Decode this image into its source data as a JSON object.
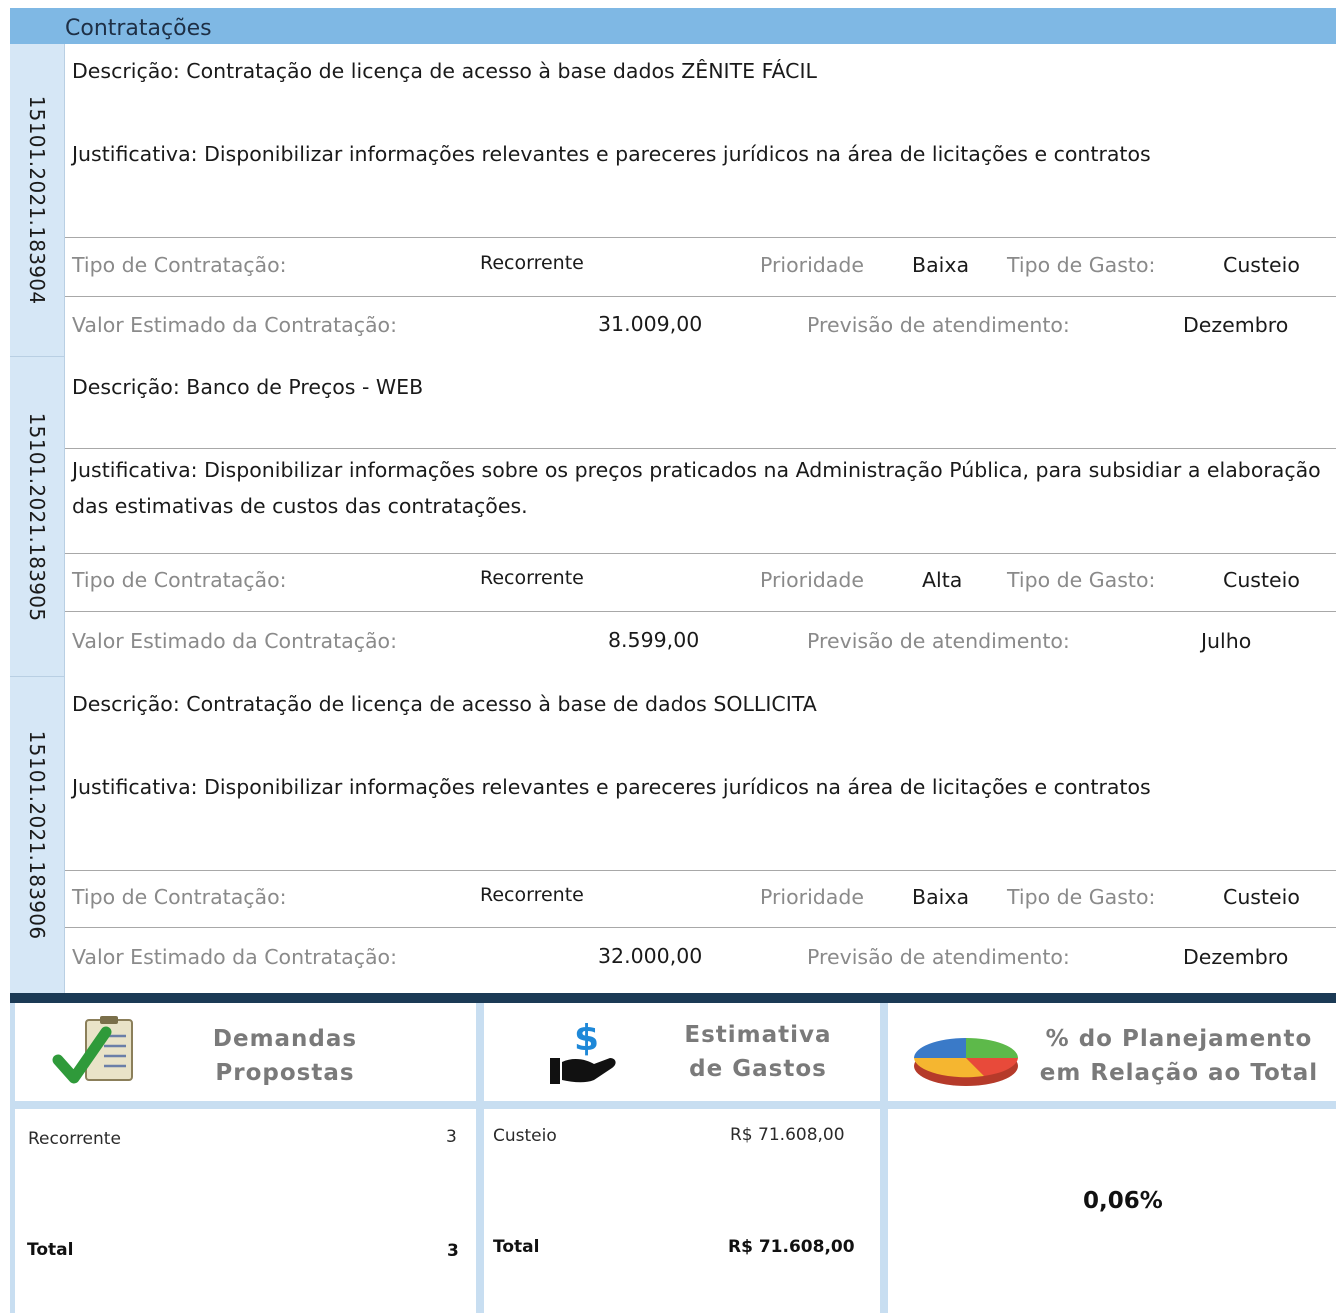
{
  "header": {
    "title": "Contratações"
  },
  "labels": {
    "descricao": "Descrição:",
    "justificativa": "Justificativa:",
    "tipo_contratacao": "Tipo de Contratação:",
    "prioridade": "Prioridade",
    "tipo_gasto": "Tipo de Gasto:",
    "valor_estimado": "Valor Estimado da Contratação:",
    "previsao": "Previsão de atendimento:"
  },
  "items": [
    {
      "id": "15101.2021.183904",
      "descricao": "Contratação de licença de acesso à base dados ZÊNITE FÁCIL",
      "justificativa": "Disponibilizar informações relevantes e pareceres jurídicos na área de licitações e contratos",
      "tipo_contratacao": "Recorrente",
      "prioridade": "Baixa",
      "tipo_gasto": "Custeio",
      "valor": "31.009,00",
      "previsao": "Dezembro"
    },
    {
      "id": "15101.2021.183905",
      "descricao": "Banco de Preços - WEB",
      "justificativa": "Disponibilizar informações sobre os preços praticados na Administração Pública, para subsidiar a elaboração das estimativas de custos das contratações.",
      "tipo_contratacao": "Recorrente",
      "prioridade": "Alta",
      "tipo_gasto": "Custeio",
      "valor": "8.599,00",
      "previsao": "Julho"
    },
    {
      "id": "15101.2021.183906",
      "descricao": "Contratação de licença de acesso à base de dados SOLLICITA",
      "justificativa": "Disponibilizar informações relevantes e pareceres jurídicos na área de licitações e contratos",
      "tipo_contratacao": "Recorrente",
      "prioridade": "Baixa",
      "tipo_gasto": "Custeio",
      "valor": "32.000,00",
      "previsao": "Dezembro"
    }
  ],
  "summary": {
    "demandas": {
      "title_line1": "Demandas",
      "title_line2": "Propostas",
      "row_label": "Recorrente",
      "row_value": "3",
      "total_label": "Total",
      "total_value": "3"
    },
    "estimativa": {
      "title_line1": "Estimativa",
      "title_line2": "de Gastos",
      "row_label": "Custeio",
      "row_value": "R$ 71.608,00",
      "total_label": "Total",
      "total_value": "R$ 71.608,00"
    },
    "planejamento": {
      "title_line1": "% do Planejamento",
      "title_line2": "em Relação ao Total",
      "value": "0,06%"
    }
  },
  "colors": {
    "header": "#7fb8e4",
    "side": "#d6e7f6",
    "dark_divider": "#1b3a55",
    "panel_separator": "#c8def1"
  }
}
